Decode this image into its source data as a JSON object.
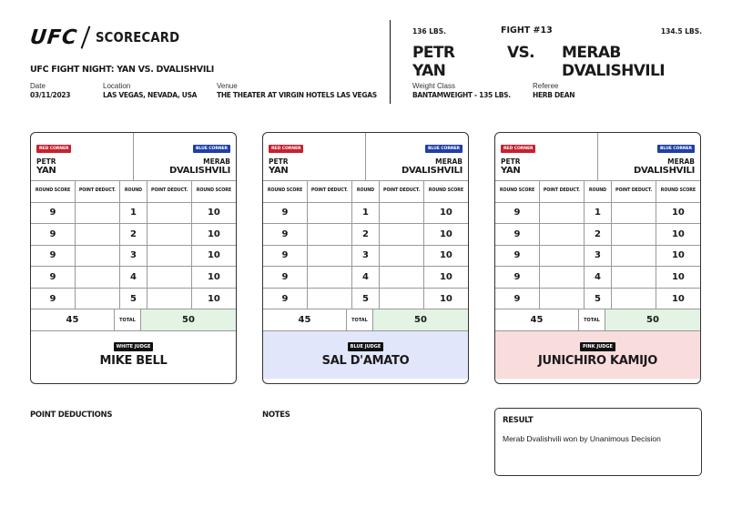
{
  "header": {
    "logo": "UFC",
    "doc_title": "SCORECARD",
    "event_name": "UFC FIGHT NIGHT: YAN VS. DVALISHVILI",
    "date_label": "Date",
    "date": "03/11/2023",
    "location_label": "Location",
    "location": "LAS VEGAS, NEVADA, USA",
    "venue_label": "Venue",
    "venue": "THE THEATER AT VIRGIN HOTELS LAS VEGAS",
    "red_weight": "136 LBS.",
    "fight_number": "FIGHT #13",
    "blue_weight": "134.5 LBS.",
    "red_fighter": "PETR YAN",
    "vs": "VS.",
    "blue_fighter": "MERAB DVALISHVILI",
    "weight_class_label": "Weight Class",
    "weight_class": "BANTAMWEIGHT - 135 LBS.",
    "referee_label": "Referee",
    "referee": "HERB DEAN"
  },
  "labels": {
    "red_corner": "RED CORNER",
    "blue_corner": "BLUE CORNER",
    "round_score": "ROUND SCORE",
    "point_deduct": "POINT DEDUCT.",
    "round": "ROUND",
    "total": "TOTAL",
    "red_first": "PETR",
    "red_last": "YAN",
    "blue_first": "MERAB",
    "blue_last": "DVALISHVILI"
  },
  "cards": [
    {
      "judge_tag": "WHITE JUDGE",
      "judge_name": "MIKE BELL",
      "judge_bg": "#ffffff",
      "rounds": [
        {
          "red": "9",
          "red_pd": "",
          "round": "1",
          "blue_pd": "",
          "blue": "10"
        },
        {
          "red": "9",
          "red_pd": "",
          "round": "2",
          "blue_pd": "",
          "blue": "10"
        },
        {
          "red": "9",
          "red_pd": "",
          "round": "3",
          "blue_pd": "",
          "blue": "10"
        },
        {
          "red": "9",
          "red_pd": "",
          "round": "4",
          "blue_pd": "",
          "blue": "10"
        },
        {
          "red": "9",
          "red_pd": "",
          "round": "5",
          "blue_pd": "",
          "blue": "10"
        }
      ],
      "red_total": "45",
      "blue_total": "50"
    },
    {
      "judge_tag": "BLUE JUDGE",
      "judge_name": "SAL D'AMATO",
      "judge_bg": "#e1e6fa",
      "rounds": [
        {
          "red": "9",
          "red_pd": "",
          "round": "1",
          "blue_pd": "",
          "blue": "10"
        },
        {
          "red": "9",
          "red_pd": "",
          "round": "2",
          "blue_pd": "",
          "blue": "10"
        },
        {
          "red": "9",
          "red_pd": "",
          "round": "3",
          "blue_pd": "",
          "blue": "10"
        },
        {
          "red": "9",
          "red_pd": "",
          "round": "4",
          "blue_pd": "",
          "blue": "10"
        },
        {
          "red": "9",
          "red_pd": "",
          "round": "5",
          "blue_pd": "",
          "blue": "10"
        }
      ],
      "red_total": "45",
      "blue_total": "50"
    },
    {
      "judge_tag": "PINK JUDGE",
      "judge_name": "JUNICHIRO KAMIJO",
      "judge_bg": "#f9dcdc",
      "rounds": [
        {
          "red": "9",
          "red_pd": "",
          "round": "1",
          "blue_pd": "",
          "blue": "10"
        },
        {
          "red": "9",
          "red_pd": "",
          "round": "2",
          "blue_pd": "",
          "blue": "10"
        },
        {
          "red": "9",
          "red_pd": "",
          "round": "3",
          "blue_pd": "",
          "blue": "10"
        },
        {
          "red": "9",
          "red_pd": "",
          "round": "4",
          "blue_pd": "",
          "blue": "10"
        },
        {
          "red": "9",
          "red_pd": "",
          "round": "5",
          "blue_pd": "",
          "blue": "10"
        }
      ],
      "red_total": "45",
      "blue_total": "50"
    }
  ],
  "footer": {
    "point_deductions_label": "POINT DEDUCTIONS",
    "notes_label": "NOTES",
    "result_label": "RESULT",
    "result_text": "Merab Dvalishvili won by Unanimous Decision"
  },
  "colors": {
    "red_corner": "#c8202f",
    "blue_corner": "#1e3ea8",
    "winner_total_bg": "#e3f3e4"
  }
}
